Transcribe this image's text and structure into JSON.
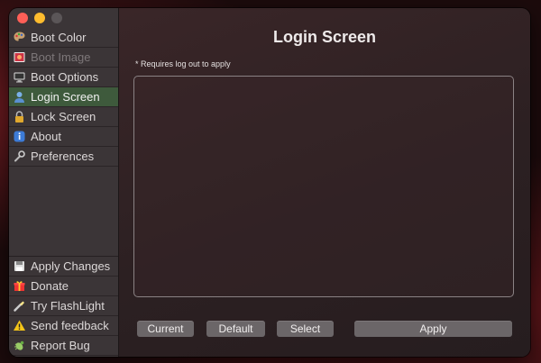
{
  "window": {
    "traffic_lights": [
      "red",
      "yellow",
      "gray"
    ]
  },
  "sidebar": {
    "items": [
      {
        "label": "Boot Color",
        "icon": "palette-icon",
        "state": "normal"
      },
      {
        "label": "Boot Image",
        "icon": "image-icon",
        "state": "disabled"
      },
      {
        "label": "Boot Options",
        "icon": "monitor-icon",
        "state": "normal"
      },
      {
        "label": "Login Screen",
        "icon": "user-icon",
        "state": "selected"
      },
      {
        "label": "Lock Screen",
        "icon": "lock-icon",
        "state": "normal"
      },
      {
        "label": "About",
        "icon": "info-icon",
        "state": "normal"
      },
      {
        "label": "Preferences",
        "icon": "gear-icon",
        "state": "normal"
      }
    ],
    "bottom_items": [
      {
        "label": "Apply Changes",
        "icon": "floppy-disk-icon"
      },
      {
        "label": "Donate",
        "icon": "gift-icon"
      },
      {
        "label": "Try FlashLight",
        "icon": "flashlight-icon"
      },
      {
        "label": "Send feedback",
        "icon": "warning-icon"
      },
      {
        "label": "Report Bug",
        "icon": "bug-icon"
      }
    ]
  },
  "main": {
    "title": "Login Screen",
    "note": "* Requires log out to apply",
    "buttons": {
      "current": "Current",
      "default": "Default",
      "select": "Select",
      "apply": "Apply"
    }
  },
  "colors": {
    "selected_bg": "#3e5a3c",
    "button_bg": "#6b6668",
    "sidebar_bg": "#3b3537"
  }
}
